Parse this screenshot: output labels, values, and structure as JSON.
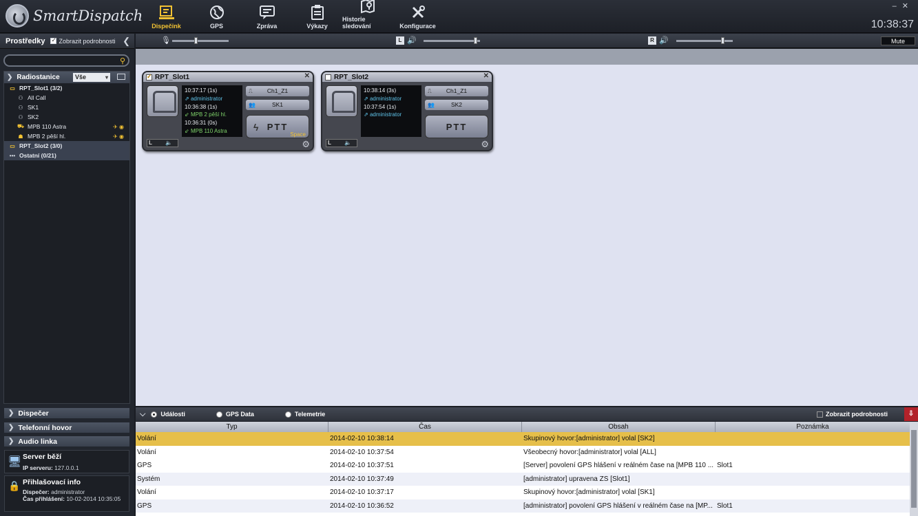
{
  "app": {
    "title": "SmartDispatch",
    "clock": "10:38:37",
    "minimize": "–",
    "close": "✕"
  },
  "nav": [
    {
      "label": "Dispečink",
      "icon": "dispatch-icon"
    },
    {
      "label": "GPS",
      "icon": "globe-icon"
    },
    {
      "label": "Zpráva",
      "icon": "message-icon"
    },
    {
      "label": "Výkazy",
      "icon": "report-icon"
    },
    {
      "label": "Historie sledování",
      "icon": "map-history-icon"
    },
    {
      "label": "Konfigurace",
      "icon": "tools-icon"
    }
  ],
  "sidebar": {
    "title": "Prostředky",
    "show_details": "Zobrazit podrobnosti",
    "search_placeholder": "",
    "radio_section": "Radiostanice",
    "filter": "Vše",
    "tree": [
      {
        "label": "RPT_Slot1 (3/2)"
      },
      {
        "label": "All Call"
      },
      {
        "label": "SK1"
      },
      {
        "label": "SK2"
      },
      {
        "label": "MPB 110 Astra"
      },
      {
        "label": "MPB 2 pěší hl."
      },
      {
        "label": "RPT_Slot2 (3/0)"
      },
      {
        "label": "Ostatní (0/21)"
      }
    ],
    "sections": [
      "Dispečer",
      "Telefonní hovor",
      "Audio linka"
    ],
    "server": {
      "title": "Server běží",
      "ip_label": "IP serveru:",
      "ip": "127.0.0.1"
    },
    "login": {
      "title": "Přihlašovací info",
      "disp_label": "Dispečer:",
      "disp": "administrator",
      "time_label": "Čas přihlášení:",
      "time": "10-02-2014 10:35:05"
    }
  },
  "toolbar": {
    "left_label": "L",
    "right_label": "R",
    "mute": "Mute",
    "mic_level": 0.42,
    "left_level": 0.95,
    "right_level": 0.85
  },
  "cards": [
    {
      "title": "RPT_Slot1",
      "log": [
        "10:37:17 (1s)",
        "administrator",
        "10:36:38 (1s)",
        "MPB 2 pěší hl.",
        "10:36:31 (0s)",
        "MPB 110 Astra"
      ],
      "channel": "Ch1_Z1",
      "group": "SK1",
      "ptt": "PTT",
      "ptt_hint": "Space",
      "lr": "L"
    },
    {
      "title": "RPT_Slot2",
      "log": [
        "10:38:14 (3s)",
        "administrator",
        "10:37:54 (1s)",
        "administrator"
      ],
      "channel": "Ch1_Z1",
      "group": "SK2",
      "ptt": "PTT",
      "lr": "L"
    }
  ],
  "events": {
    "tabs": [
      "Události",
      "GPS Data",
      "Telemetrie"
    ],
    "show_details": "Zobrazit podrobnosti",
    "columns": [
      "Typ",
      "Čas",
      "Obsah",
      "Poznámka"
    ],
    "rows": [
      {
        "typ": "Volání",
        "cas": "2014-02-10 10:38:14",
        "obsah": "Skupinový hovor:[administrator] volal [SK2]",
        "pozn": ""
      },
      {
        "typ": "Volání",
        "cas": "2014-02-10 10:37:54",
        "obsah": "Všeobecný hovor:[administrator] volal [ALL]",
        "pozn": ""
      },
      {
        "typ": "GPS",
        "cas": "2014-02-10 10:37:51",
        "obsah": "[Server] povolení GPS hlášení v reálném čase na [MPB 110 ...",
        "pozn": "Slot1"
      },
      {
        "typ": "Systém",
        "cas": "2014-02-10 10:37:49",
        "obsah": "[administrator] upravena ZS [Slot1]",
        "pozn": ""
      },
      {
        "typ": "Volání",
        "cas": "2014-02-10 10:37:17",
        "obsah": "Skupinový hovor:[administrator] volal [SK1]",
        "pozn": ""
      },
      {
        "typ": "GPS",
        "cas": "2014-02-10 10:36:52",
        "obsah": "[administrator] povolení GPS hlášení v reálném čase na [MP...",
        "pozn": "Slot1"
      }
    ]
  }
}
